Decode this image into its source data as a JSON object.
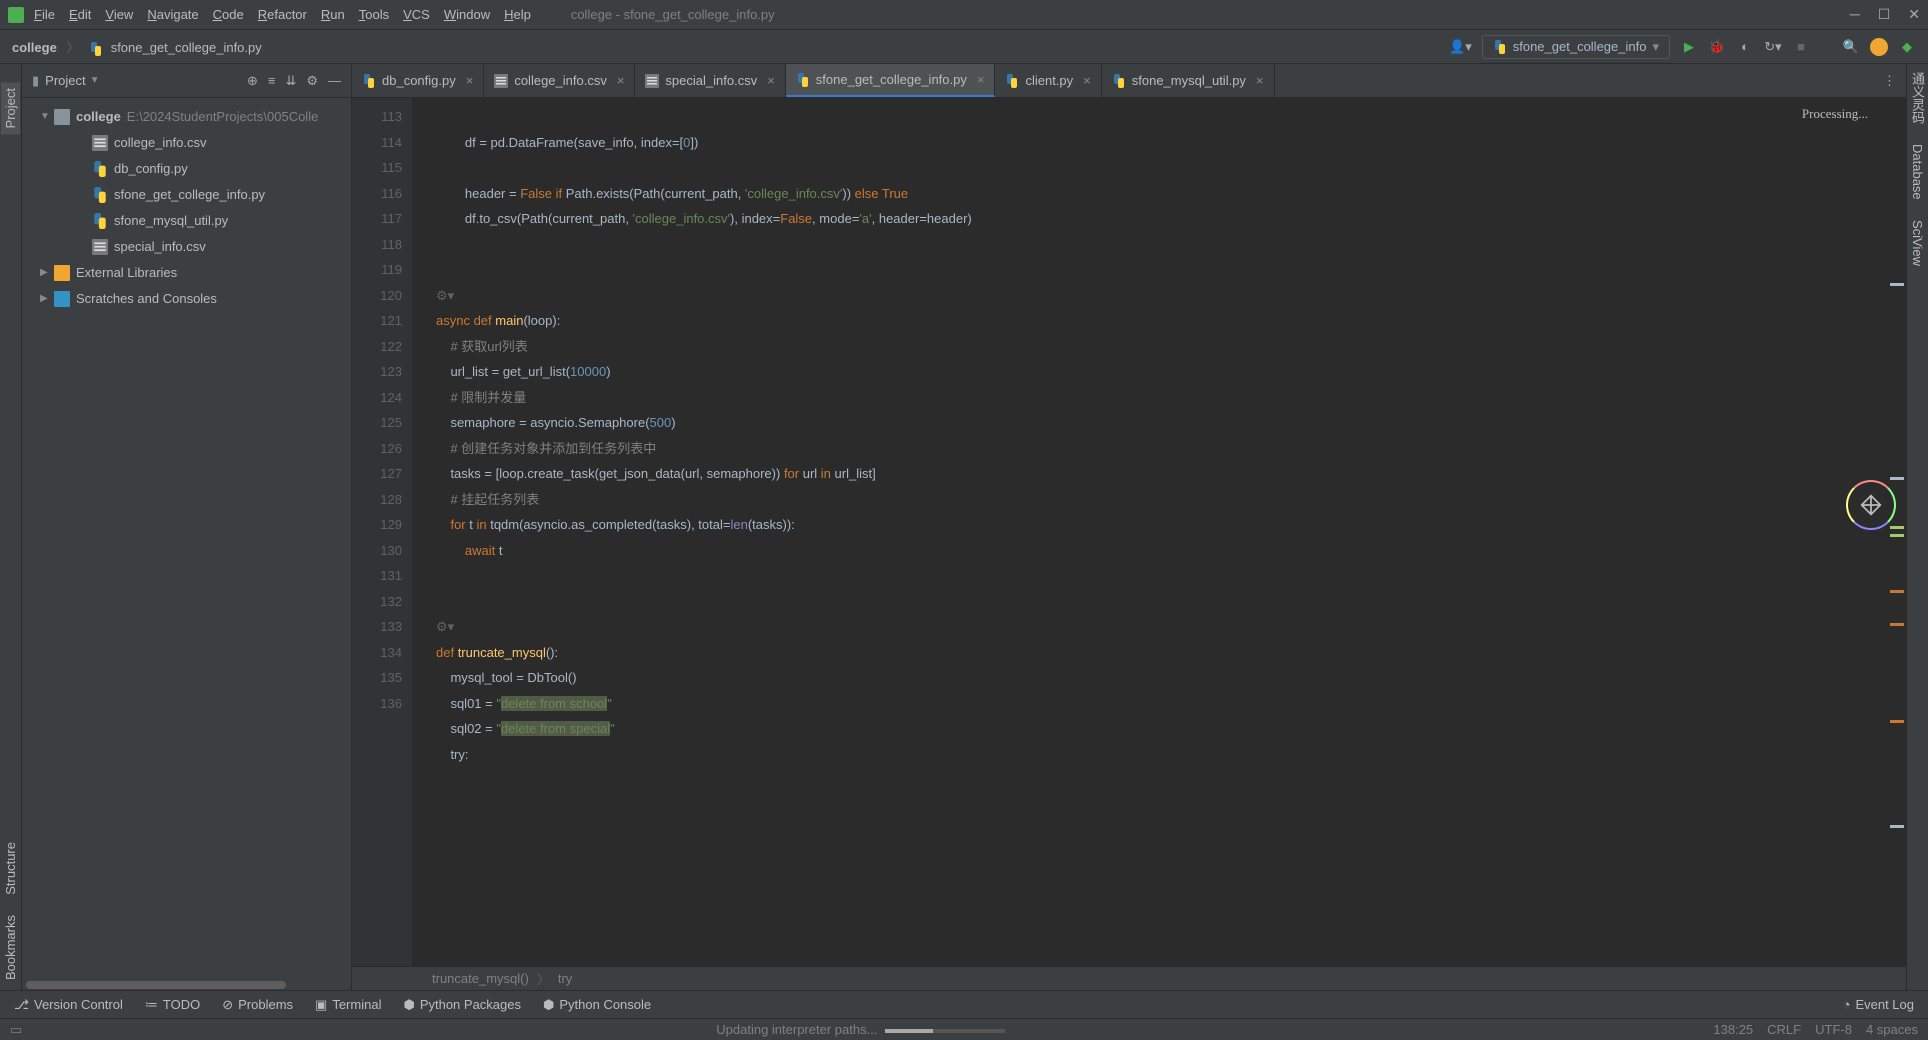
{
  "menu": [
    "File",
    "Edit",
    "View",
    "Navigate",
    "Code",
    "Refactor",
    "Run",
    "Tools",
    "VCS",
    "Window",
    "Help"
  ],
  "window_title": "college - sfone_get_college_info.py",
  "breadcrumb": {
    "root": "college",
    "file": "sfone_get_college_info.py"
  },
  "run_config": "sfone_get_college_info",
  "project_panel": {
    "title": "Project"
  },
  "tree": {
    "root": {
      "name": "college",
      "path": "E:\\2024StudentProjects\\005Colle"
    },
    "files": [
      "college_info.csv",
      "db_config.py",
      "sfone_get_college_info.py",
      "sfone_mysql_util.py",
      "special_info.csv"
    ],
    "ext": [
      "External Libraries",
      "Scratches and Consoles"
    ]
  },
  "tabs": [
    {
      "name": "db_config.py",
      "type": "py",
      "active": false
    },
    {
      "name": "college_info.csv",
      "type": "csv",
      "active": false
    },
    {
      "name": "special_info.csv",
      "type": "csv",
      "active": false
    },
    {
      "name": "sfone_get_college_info.py",
      "type": "py",
      "active": true
    },
    {
      "name": "client.py",
      "type": "py",
      "active": false
    },
    {
      "name": "sfone_mysql_util.py",
      "type": "py",
      "active": false
    }
  ],
  "processing_label": "Processing...",
  "line_start": 113,
  "code_lines": [
    {
      "n": 113,
      "html": ""
    },
    {
      "n": 114,
      "html": "        df = pd.DataFrame(save_info, <span class='par'>index</span>=[<span class='num'>0</span>])"
    },
    {
      "n": 115,
      "html": ""
    },
    {
      "n": 116,
      "html": "        header = <span class='kw'>False if</span> Path.exists(Path(current_path, <span class='str'>'college_info.csv'</span>)) <span class='kw'>else True</span>"
    },
    {
      "n": 117,
      "html": "        df.to_csv(Path(current_path, <span class='str'>'college_info.csv'</span>), <span class='par'>index</span>=<span class='kw'>False</span>, <span class='par'>mode</span>=<span class='str'>'a'</span>, <span class='par'>header</span>=header)"
    },
    {
      "n": 118,
      "html": ""
    },
    {
      "n": 119,
      "html": ""
    },
    {
      "n": "",
      "html": "",
      "action": true
    },
    {
      "n": 120,
      "html": "<span class='kw'>async def </span><span class='fn'>main</span>(loop):"
    },
    {
      "n": 121,
      "html": "    <span class='cmt'># 获取url列表</span>"
    },
    {
      "n": 122,
      "html": "    url_list = get_url_list(<span class='num'>10000</span>)"
    },
    {
      "n": 123,
      "html": "    <span class='cmt'># 限制并发量</span>"
    },
    {
      "n": 124,
      "html": "    semaphore = asyncio.Semaphore(<span class='num'>500</span>)"
    },
    {
      "n": 125,
      "html": "    <span class='cmt'># 创建任务对象并添加到任务列表中</span>"
    },
    {
      "n": 126,
      "html": "    tasks = [loop.create_task(get_json_data(url, semaphore)) <span class='kw'>for</span> url <span class='kw'>in</span> url_list]"
    },
    {
      "n": 127,
      "html": "    <span class='cmt'># 挂起任务列表</span>"
    },
    {
      "n": 128,
      "html": "    <span class='kw'>for</span> t <span class='kw'>in</span> tqdm(asyncio.as_completed(tasks), <span class='par'>total</span>=<span class='bi'>len</span>(tasks)):"
    },
    {
      "n": 129,
      "html": "        <span class='kw'>await</span> t"
    },
    {
      "n": 130,
      "html": ""
    },
    {
      "n": 131,
      "html": ""
    },
    {
      "n": "",
      "html": "",
      "action": true
    },
    {
      "n": 132,
      "html": "<span class='kw'>def </span><span class='fn'>truncate_mysql</span>():"
    },
    {
      "n": 133,
      "html": "    mysql_tool = DbTool()"
    },
    {
      "n": 134,
      "html": "    sql01 = <span class='str'>\"</span><span class='hl'><span class='str'>delete from school</span></span><span class='str'>\"</span>"
    },
    {
      "n": 135,
      "html": "    sql02 = <span class='str'>\"</span><span class='hl'><span class='str'>delete from special</span></span><span class='str'>\"</span>"
    },
    {
      "n": 136,
      "html": "    try:"
    }
  ],
  "editor_breadcrumb": [
    "truncate_mysql()",
    "try"
  ],
  "left_tabs": [
    "Project",
    "Structure",
    "Bookmarks"
  ],
  "right_tabs": [
    "通义灵码",
    "Database",
    "SciView"
  ],
  "bottom_tabs": [
    "Version Control",
    "TODO",
    "Problems",
    "Terminal",
    "Python Packages",
    "Python Console"
  ],
  "event_log": "Event Log",
  "status": {
    "msg": "Updating interpreter paths...",
    "pos": "138:25",
    "sep": "CRLF",
    "enc": "UTF-8",
    "indent": "4 spaces"
  }
}
